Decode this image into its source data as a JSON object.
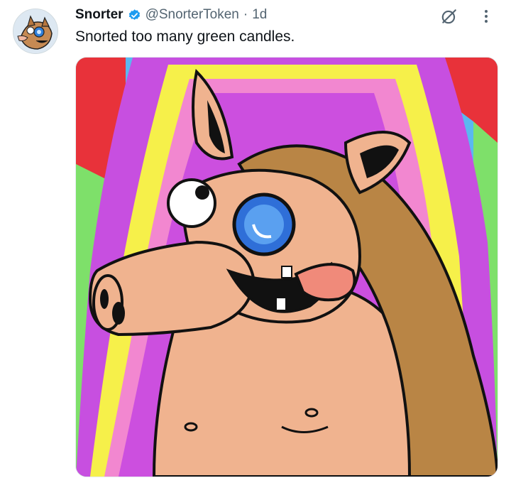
{
  "tweet": {
    "author_name": "Snorter",
    "handle": "@SnorterToken",
    "separator": "·",
    "time": "1d",
    "text": "Snorted too many green candles.",
    "verified_icon": "verified-badge-icon",
    "actions": {
      "grok_icon": "grok-icon",
      "more_icon": "more-vertical-icon"
    },
    "media": {
      "type": "image",
      "description_icon": "cartoon-image"
    }
  },
  "colors": {
    "text_primary": "#0f1419",
    "text_secondary": "#536471",
    "verified_blue": "#1d9bf0"
  }
}
